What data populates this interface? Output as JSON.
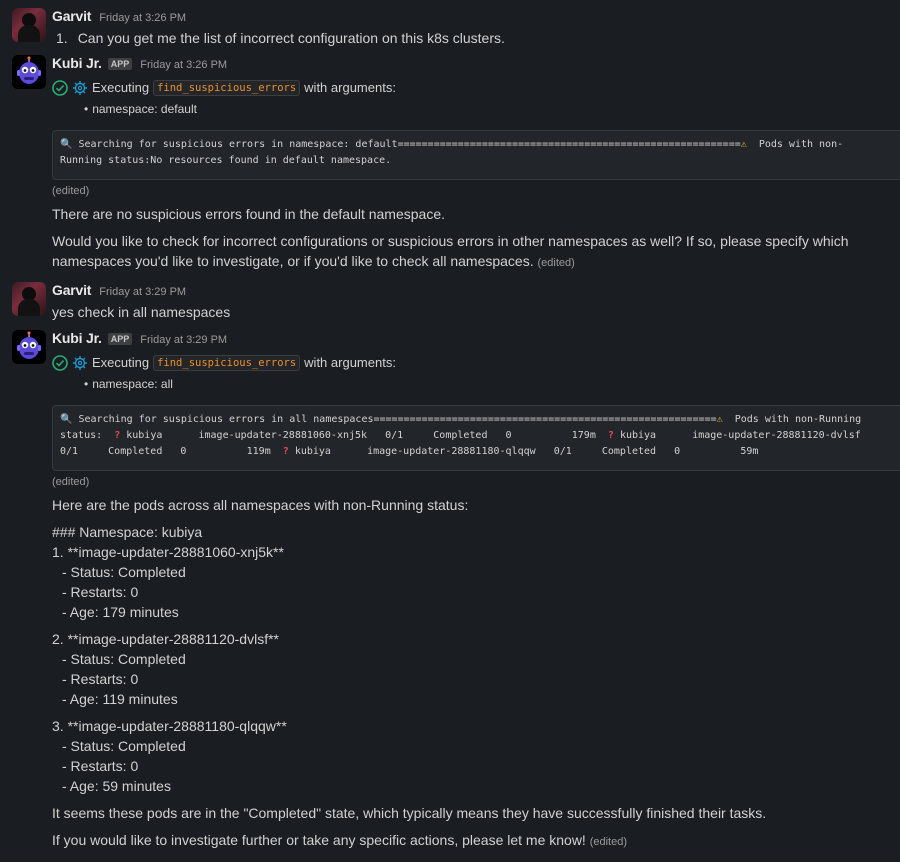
{
  "messages": [
    {
      "author": "Garvit",
      "time": "Friday at 3:26 PM",
      "text_num": "1.",
      "text": "Can you get me the list of incorrect configuration on this k8s  clusters."
    },
    {
      "author": "Kubi Jr.",
      "badge": "APP",
      "time": "Friday at 3:26 PM",
      "exec_prefix": "Executing",
      "exec_fn": "find_suspicious_errors",
      "exec_suffix": "with arguments:",
      "arg": "namespace: default",
      "code_line1_a": "Searching for suspicious errors in namespace: default=========================================================",
      "code_line1_b": "  Pods with non-",
      "code_line2": "Running status:No resources found in default namespace.",
      "edited": "(edited)",
      "p1": "There are no suspicious errors found in the default namespace.",
      "p2a": "Would you like to check for incorrect configurations or suspicious errors in other namespaces as well? If so, please specify which",
      "p2b": "namespaces you'd like to investigate, or if you'd like to check all namespaces.",
      "p2_edited": "(edited)"
    },
    {
      "author": "Garvit",
      "time": "Friday at 3:29 PM",
      "text": "yes check in all namespaces"
    },
    {
      "author": "Kubi Jr.",
      "badge": "APP",
      "time": "Friday at 3:29 PM",
      "exec_prefix": "Executing",
      "exec_fn": "find_suspicious_errors",
      "exec_suffix": "with arguments:",
      "arg": "namespace: all",
      "code_l1_a": "Searching for suspicious errors in all namespaces=========================================================",
      "code_l1_b": "  Pods with non-Running",
      "code_l2_a": "status:  ",
      "code_l2_b": " kubiya      image-updater-28881060-xnj5k   0/1     Completed   0          179m  ",
      "code_l2_c": " kubiya      image-updater-28881120-dvlsf",
      "code_l3_a": "0/1     Completed   0          119m  ",
      "code_l3_b": " kubiya      image-updater-28881180-qlqqw   0/1     Completed   0          59m",
      "edited": "(edited)",
      "intro": "Here are the pods across all namespaces with non-Running status:",
      "ns_heading": "### Namespace: kubiya",
      "pods": [
        {
          "title": "1. **image-updater-28881060-xnj5k**",
          "status": "- Status: Completed",
          "restarts": "- Restarts: 0",
          "age": "- Age: 179 minutes"
        },
        {
          "title": "2. **image-updater-28881120-dvlsf**",
          "status": "- Status: Completed",
          "restarts": "- Restarts: 0",
          "age": "- Age: 119 minutes"
        },
        {
          "title": "3. **image-updater-28881180-qlqqw**",
          "status": "- Status: Completed",
          "restarts": "- Restarts: 0",
          "age": "- Age: 59 minutes"
        }
      ],
      "p_completed": "It seems these pods are in the \"Completed\" state, which typically means they have successfully finished their tasks.",
      "p_final": "If you would like to investigate further or take any specific actions, please let me know!",
      "p_final_edited": "(edited)"
    }
  ],
  "colors": {
    "background": "#1a1d21",
    "text": "#d1d2d3",
    "muted": "#9a9b9d",
    "code_accent": "#e8912d",
    "check_green": "#2bac76",
    "gear_blue": "#1d9bd1"
  },
  "icons": {
    "exec_status": "check-circle-icon",
    "exec_tool": "gear-icon",
    "search": "magnifier-icon",
    "warning": "warning-icon",
    "question": "question-mark-icon"
  }
}
